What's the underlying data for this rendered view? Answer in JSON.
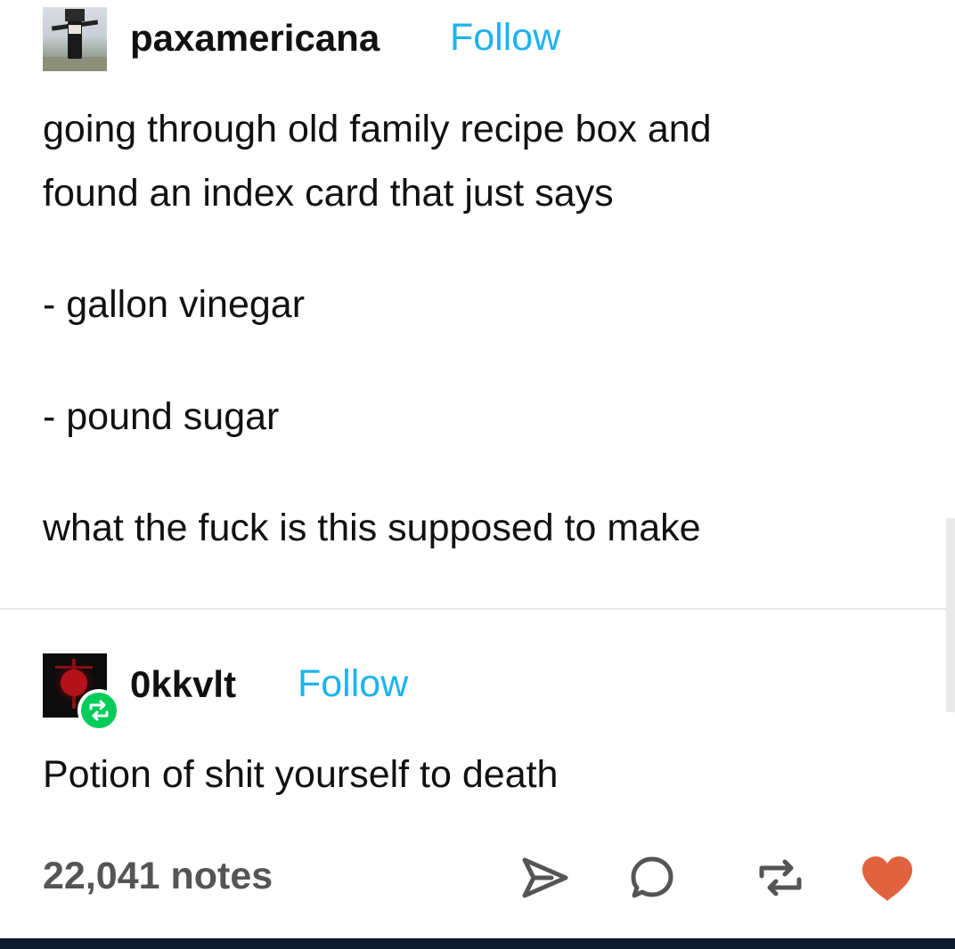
{
  "post": {
    "author": {
      "username": "paxamericana",
      "follow_label": "Follow",
      "avatar_icon": "user-avatar-icon"
    },
    "text_lines": [
      "going through old family recipe box and",
      "found an index card that just says",
      "- gallon vinegar",
      "- pound sugar",
      "what the fuck is this supposed to make"
    ]
  },
  "reblog": {
    "author": {
      "username": "0kkvlt",
      "follow_label": "Follow",
      "avatar_icon": "user-avatar-icon",
      "badge_icon": "reblog-icon"
    },
    "text": "Potion of shit yourself to death"
  },
  "footer": {
    "notes": "22,041 notes",
    "actions": [
      {
        "name": "share",
        "icon": "send-icon"
      },
      {
        "name": "reply",
        "icon": "comment-icon"
      },
      {
        "name": "reblog",
        "icon": "reblog-icon"
      },
      {
        "name": "like",
        "icon": "heart-icon",
        "color": "#e0623f"
      }
    ]
  },
  "colors": {
    "follow": "#1db3ef",
    "reblog_badge": "#00cc5a",
    "like": "#e0623f",
    "bottom_bar": "#0e1a2b"
  }
}
